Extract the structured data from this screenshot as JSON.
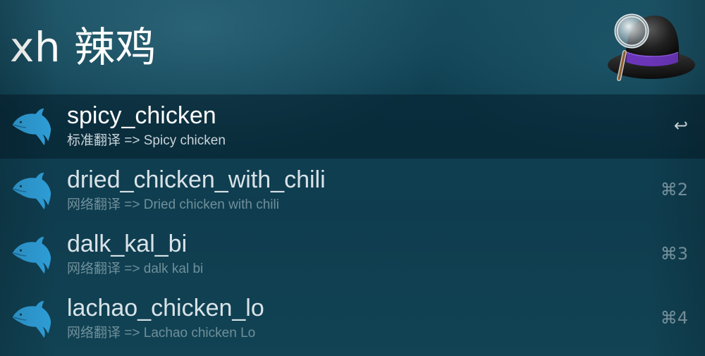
{
  "query": {
    "text": "xh 辣鸡"
  },
  "app_icon": "alfred-hat-icon",
  "results": [
    {
      "title": "spicy_chicken",
      "subtitle": "标准翻译 => Spicy chicken",
      "shortcut": "↩",
      "icon": "dolphin-icon",
      "selected": true
    },
    {
      "title": "dried_chicken_with_chili",
      "subtitle": "网络翻译 => Dried chicken with chili",
      "shortcut": "⌘2",
      "icon": "dolphin-icon",
      "selected": false
    },
    {
      "title": "dalk_kal_bi",
      "subtitle": "网络翻译 => dalk kal bi",
      "shortcut": "⌘3",
      "icon": "dolphin-icon",
      "selected": false
    },
    {
      "title": "lachao_chicken_lo",
      "subtitle": "网络翻译 => Lachao chicken Lo",
      "shortcut": "⌘4",
      "icon": "dolphin-icon",
      "selected": false
    }
  ],
  "colors": {
    "background": "#0f3d4f",
    "selected_row": "#0a2a38",
    "dolphin": "#2f9fd9",
    "hat_band": "#6a35b8"
  }
}
